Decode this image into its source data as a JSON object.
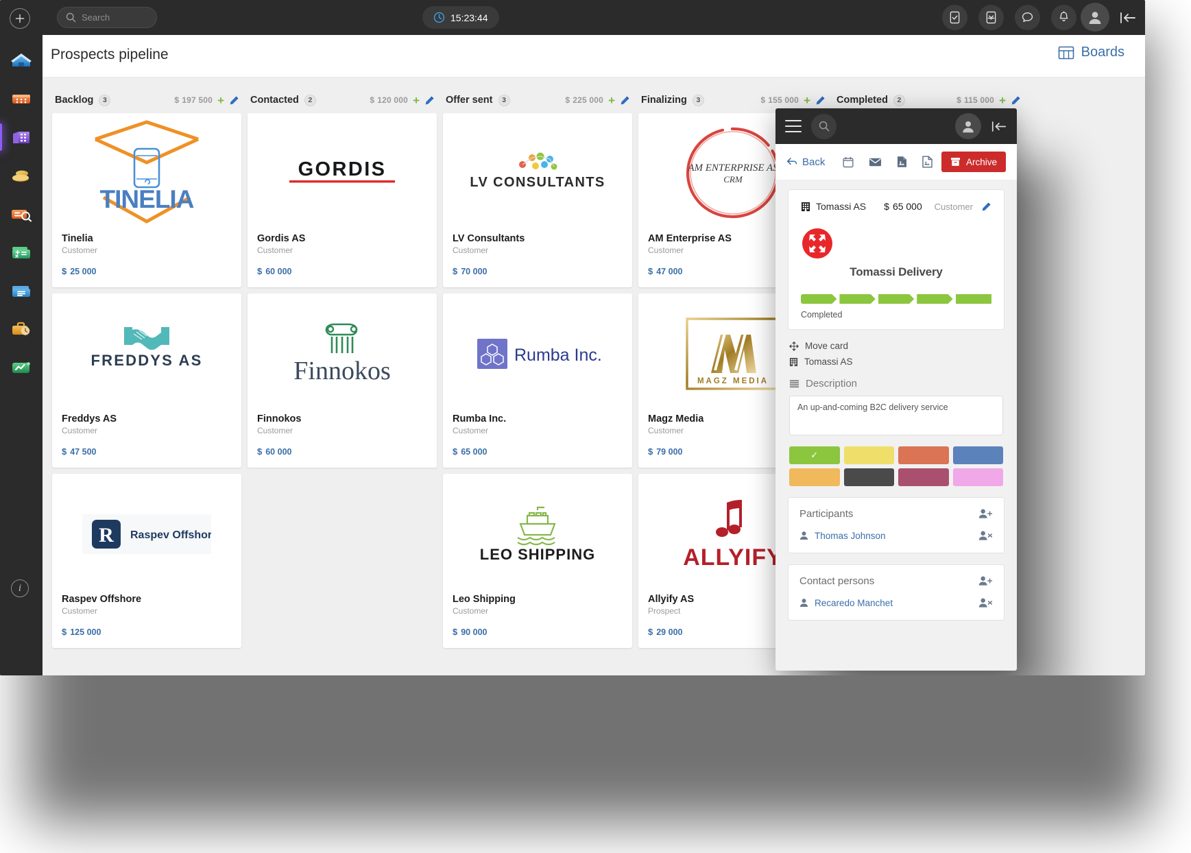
{
  "topbar": {
    "add_label": "+",
    "search_placeholder": "Search",
    "clock": "15:23:44",
    "icons": [
      "task-check-icon",
      "inbox-icon",
      "chat-icon",
      "bell-icon"
    ],
    "avatar": "user-avatar",
    "collapse": "collapse-panel-icon"
  },
  "sidebar": {
    "items": [
      {
        "name": "home",
        "color": "#2f86d6"
      },
      {
        "name": "calendar",
        "color": "#e8743b"
      },
      {
        "name": "company",
        "color": "#8a5cd6"
      },
      {
        "name": "coins",
        "color": "#e8b93b"
      },
      {
        "name": "search-contacts",
        "color": "#e8743b"
      },
      {
        "name": "accounting",
        "color": "#3fb984"
      },
      {
        "name": "documents",
        "color": "#3f95d6"
      },
      {
        "name": "timesheet",
        "color": "#e8a33b"
      },
      {
        "name": "reports",
        "color": "#3fa85c"
      }
    ],
    "info_label": "i"
  },
  "header": {
    "title": "Prospects pipeline",
    "boards_label": "Boards"
  },
  "board": {
    "columns": [
      {
        "name": "Backlog",
        "count": "3",
        "sum": "197 500",
        "currency": "$",
        "cards": [
          {
            "logo": "tinelia",
            "title": "Tinelia",
            "type": "Customer",
            "amount": "25 000",
            "currency": "$"
          },
          {
            "logo": "freddys",
            "title": "Freddys AS",
            "type": "Customer",
            "amount": "47 500",
            "currency": "$"
          },
          {
            "logo": "raspev",
            "title": "Raspev Offshore",
            "type": "Customer",
            "amount": "125 000",
            "currency": "$"
          }
        ]
      },
      {
        "name": "Contacted",
        "count": "2",
        "sum": "120 000",
        "currency": "$",
        "cards": [
          {
            "logo": "gordis",
            "title": "Gordis AS",
            "type": "Customer",
            "amount": "60 000",
            "currency": "$"
          },
          {
            "logo": "finnokos",
            "title": "Finnokos",
            "type": "Customer",
            "amount": "60 000",
            "currency": "$"
          }
        ]
      },
      {
        "name": "Offer sent",
        "count": "3",
        "sum": "225 000",
        "currency": "$",
        "cards": [
          {
            "logo": "lvconsultants",
            "title": "LV Consultants",
            "type": "Customer",
            "amount": "70 000",
            "currency": "$"
          },
          {
            "logo": "rumba",
            "title": "Rumba Inc.",
            "type": "Customer",
            "amount": "65 000",
            "currency": "$"
          },
          {
            "logo": "leoshipping",
            "title": "Leo Shipping",
            "type": "Customer",
            "amount": "90 000",
            "currency": "$"
          }
        ]
      },
      {
        "name": "Finalizing",
        "count": "3",
        "sum": "155 000",
        "currency": "$",
        "cards": [
          {
            "logo": "amenterprise",
            "title": "AM Enterprise AS",
            "type": "Customer",
            "amount": "47 000",
            "currency": "$"
          },
          {
            "logo": "magzmedia",
            "title": "Magz Media",
            "type": "Customer",
            "amount": "79 000",
            "currency": "$"
          },
          {
            "logo": "allyify",
            "title": "Allyify AS",
            "type": "Prospect",
            "amount": "29 000",
            "currency": "$"
          }
        ]
      },
      {
        "name": "Completed",
        "count": "2",
        "sum": "115 000",
        "currency": "$",
        "cards": []
      }
    ]
  },
  "detail": {
    "window": {
      "burger": "menu-icon",
      "search": "search-icon",
      "avatar": "user-avatar",
      "collapse": "collapse-panel-icon"
    },
    "toolbar": {
      "back_label": "Back",
      "tools": [
        "calendar-icon",
        "email-icon",
        "image-file-icon",
        "document-file-icon"
      ],
      "archive_label": "Archive"
    },
    "card": {
      "company": "Tomassi AS",
      "currency": "$",
      "amount": "65 000",
      "role": "Customer",
      "edit": "pencil-icon",
      "logo_name": "Tomassi Delivery",
      "logo_color": "#e8272b",
      "progress_segments": 5,
      "progress_filled": 5,
      "progress_color": "#8cc63f",
      "status": "Completed"
    },
    "move_card_label": "Move card",
    "company_label": "Tomassi AS",
    "description_label": "Description",
    "description_text": "An up-and-coming B2C delivery service",
    "swatches": [
      {
        "color": "#8cc63f",
        "selected": true
      },
      {
        "color": "#efdf6a",
        "selected": false
      },
      {
        "color": "#db7355",
        "selected": false
      },
      {
        "color": "#5b82bb",
        "selected": false
      },
      {
        "color": "#efb95c",
        "selected": false
      },
      {
        "color": "#4a4a4a",
        "selected": false
      },
      {
        "color": "#a9506f",
        "selected": false
      },
      {
        "color": "#f0a8e8",
        "selected": false
      }
    ],
    "participants": {
      "title": "Participants",
      "add_icon": "add-person-icon",
      "people": [
        {
          "name": "Thomas Johnson",
          "remove_icon": "remove-person-icon"
        }
      ]
    },
    "contacts": {
      "title": "Contact persons",
      "add_icon": "add-person-icon",
      "people": [
        {
          "name": "Recaredo Manchet",
          "remove_icon": "remove-person-icon"
        }
      ]
    }
  }
}
